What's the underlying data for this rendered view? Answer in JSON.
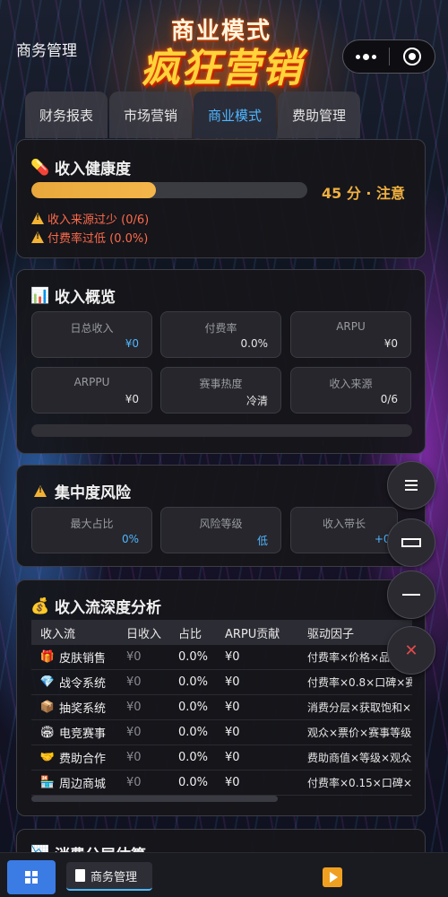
{
  "header": {
    "app_title": "商务管理",
    "banner_line1": "商业模式",
    "banner_line2": "疯狂营销"
  },
  "tabs": [
    {
      "label": "财务报表",
      "active": false
    },
    {
      "label": "市场营销",
      "active": false
    },
    {
      "label": "商业模式",
      "active": true
    },
    {
      "label": "费助管理",
      "active": false
    }
  ],
  "health": {
    "title": "收入健康度",
    "score_text": "45 分 · 注意",
    "progress": 0.45,
    "warnings": [
      "收入来源过少 (0/6)",
      "付费率过低 (0.0%)"
    ]
  },
  "overview": {
    "title": "收入概览",
    "stats": [
      {
        "label": "日总收入",
        "value": "¥0"
      },
      {
        "label": "付费率",
        "value": "0.0%"
      },
      {
        "label": "ARPU",
        "value": "¥0"
      },
      {
        "label": "ARPPU",
        "value": "¥0"
      },
      {
        "label": "赛事热度",
        "value": "冷清"
      },
      {
        "label": "收入来源",
        "value": "0/6"
      }
    ]
  },
  "risk": {
    "title": "集中度风险",
    "stats": [
      {
        "label": "最大占比",
        "value": "0%"
      },
      {
        "label": "风险等级",
        "value": "低"
      },
      {
        "label": "收入带长",
        "value": "+0.0"
      }
    ]
  },
  "streams": {
    "title": "收入流深度分析",
    "headers": [
      "收入流",
      "日收入",
      "占比",
      "ARPU贡献",
      "驱动因子"
    ],
    "rows": [
      {
        "icon": "🎁",
        "name": "皮肤销售",
        "daily": "¥0",
        "share": "0.0%",
        "arpu": "¥0",
        "driver": "付费率×价格×品"
      },
      {
        "icon": "💎",
        "name": "战令系统",
        "daily": "¥0",
        "share": "0.0%",
        "arpu": "¥0",
        "driver": "付费率×0.8×口碑×赛"
      },
      {
        "icon": "📦",
        "name": "抽奖系统",
        "daily": "¥0",
        "share": "0.0%",
        "arpu": "¥0",
        "driver": "消费分层×获取饱和×"
      },
      {
        "icon": "🏟",
        "name": "电竞赛事",
        "daily": "¥0",
        "share": "0.0%",
        "arpu": "¥0",
        "driver": "观众×票价×赛事等级"
      },
      {
        "icon": "🤝",
        "name": "费助合作",
        "daily": "¥0",
        "share": "0.0%",
        "arpu": "¥0",
        "driver": "费助商值×等级×观众"
      },
      {
        "icon": "🏪",
        "name": "周边商城",
        "daily": "¥0",
        "share": "0.0%",
        "arpu": "¥0",
        "driver": "付费率×0.15×口碑×赛"
      }
    ]
  },
  "next_section": {
    "title": "消费分层估算"
  },
  "taskbar": {
    "task_label": "商务管理"
  },
  "colors": {
    "accent": "#4fb6ff",
    "warning": "#f0b040",
    "danger": "#ff6a4a"
  }
}
